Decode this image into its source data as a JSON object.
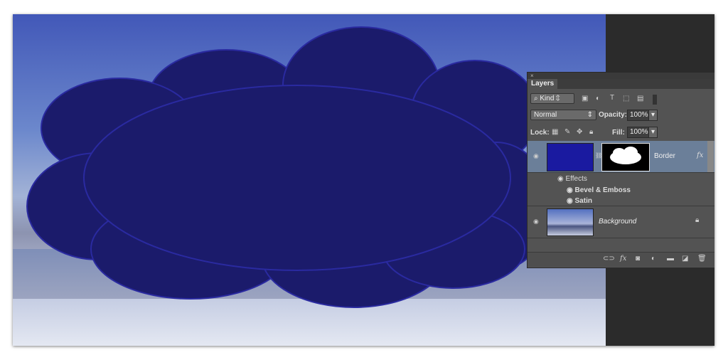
{
  "panel": {
    "close": "×",
    "tab": "Layers",
    "filter_kind": "Kind",
    "blend_mode": "Normal",
    "opacity_label": "Opacity:",
    "opacity": "100%",
    "lock_label": "Lock:",
    "fill_label": "Fill:",
    "fill": "100%"
  },
  "layers": [
    {
      "name": "Border",
      "fx": "fx",
      "effects_label": "Effects",
      "effects": [
        "Bevel & Emboss",
        "Satin"
      ],
      "color": "#1a1aa0",
      "selected": true
    },
    {
      "name": "Background",
      "locked": true
    }
  ],
  "footer_icons": [
    "link-icon",
    "fx-icon",
    "mask-icon",
    "adjustment-icon",
    "folder-icon",
    "new-layer-icon",
    "trash-icon"
  ],
  "colors": {
    "shape": "#1b1b6b",
    "panel": "#535353",
    "selected_row": "#6b7f99"
  }
}
